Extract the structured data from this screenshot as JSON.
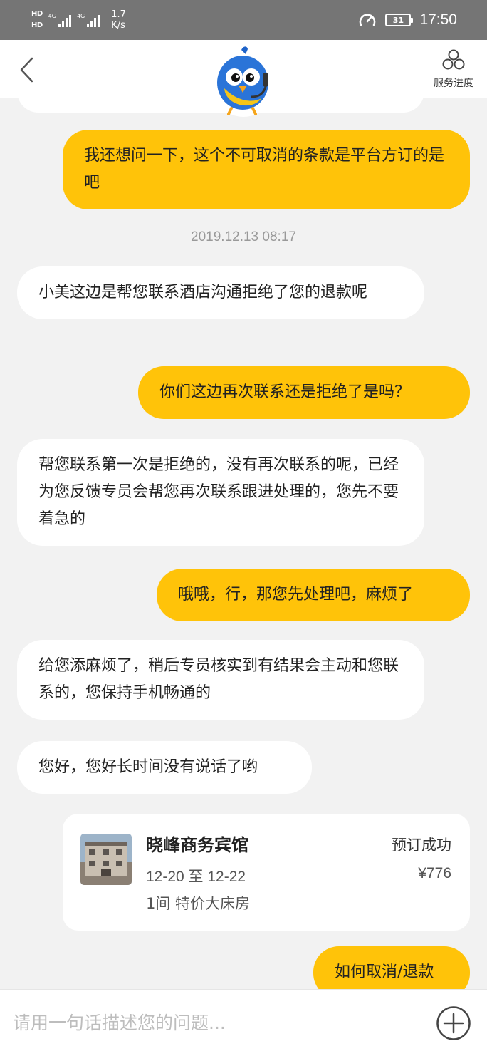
{
  "status_bar": {
    "hd1": "HD",
    "hd2": "HD",
    "net1": "4G",
    "net2": "4G",
    "speed_value": "1.7",
    "speed_unit": "K/s",
    "battery": "31",
    "time": "17:50"
  },
  "header": {
    "back_icon": "chevron-left-icon",
    "avatar": "bird-mascot-avatar",
    "progress_label": "服务进度",
    "progress_icon": "service-progress-icon"
  },
  "messages": [
    {
      "from": "user",
      "text": "我还想问一下，这个不可取消的条款是平台方订的是吧"
    },
    {
      "from": "agent",
      "text": "小美这边是帮您联系酒店沟通拒绝了您的退款呢"
    },
    {
      "from": "user",
      "text": "你们这边再次联系还是拒绝了是吗？"
    },
    {
      "from": "agent",
      "text": "帮您联系第一次是拒绝的，没有再次联系的呢，已经为您反馈专员会帮您再次联系跟进处理的，您先不要着急的"
    },
    {
      "from": "user",
      "text": "哦哦，行，那您先处理吧，麻烦了"
    },
    {
      "from": "agent",
      "text": "给您添麻烦了，稍后专员核实到有结果会主动和您联系的，您保持手机畅通的"
    },
    {
      "from": "agent",
      "text": "您好，您好长时间没有说话了哟"
    },
    {
      "from": "user",
      "text": "如何取消/退款"
    }
  ],
  "timestamp": "2019.12.13 08:17",
  "order_card": {
    "hotel_name": "晓峰商务宾馆",
    "status": "预订成功",
    "dates": "12-20 至 12-22",
    "price": "¥776",
    "room": "1间 特价大床房"
  },
  "input": {
    "placeholder": "请用一句话描述您的问题..."
  },
  "colors": {
    "user_bubble": "#ffc309",
    "agent_bubble": "#ffffff",
    "background": "#f2f2f2",
    "status_bar": "#757575"
  }
}
